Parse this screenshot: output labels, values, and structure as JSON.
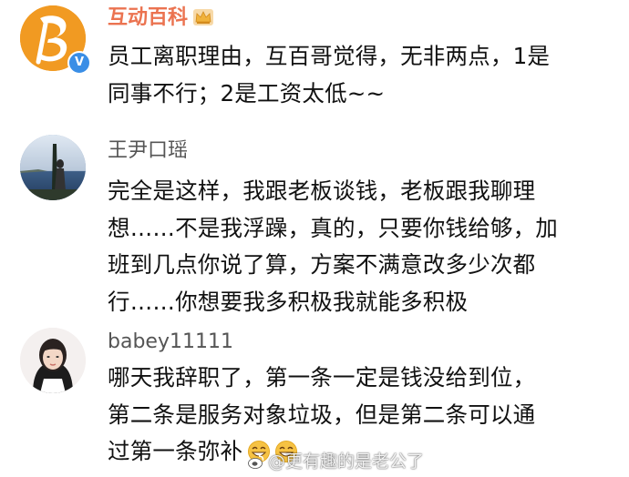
{
  "comments": [
    {
      "username": "互动百科",
      "verified_badge": "V",
      "lines": [
        "员工离职理由，互百哥觉得，无非两点，1是",
        "同事不行；2是工资太低~~"
      ]
    },
    {
      "username": "王尹口瑶",
      "lines": [
        "完全是这样，我跟老板谈钱，老板跟我聊理",
        "想……不是我浮躁，真的，只要你钱给够，加",
        "班到几点你说了算，方案不满意改多少次都",
        "行……你想要我多积极我就能多积极"
      ]
    },
    {
      "username": "babey11111",
      "lines": [
        "哪天我辞职了，第一条一定是钱没给到位，",
        "第二条是服务对象垃圾，但是第二条可以通",
        "过第一条弥补"
      ]
    }
  ],
  "watermark": {
    "text": "@更有趣的是老公了"
  },
  "colors": {
    "brand_name": "#eb7350",
    "username": "#555555",
    "body_text": "#111111",
    "verified": "#3a8ee6",
    "crown": "#f0b23c"
  },
  "icons": {
    "brand_avatar": "letter-b-logo",
    "crown_badge": "crown-icon",
    "verified": "verified-v-icon",
    "emoji": "grin-emoji-icon",
    "watermark_logo": "weibo-logo-icon"
  }
}
